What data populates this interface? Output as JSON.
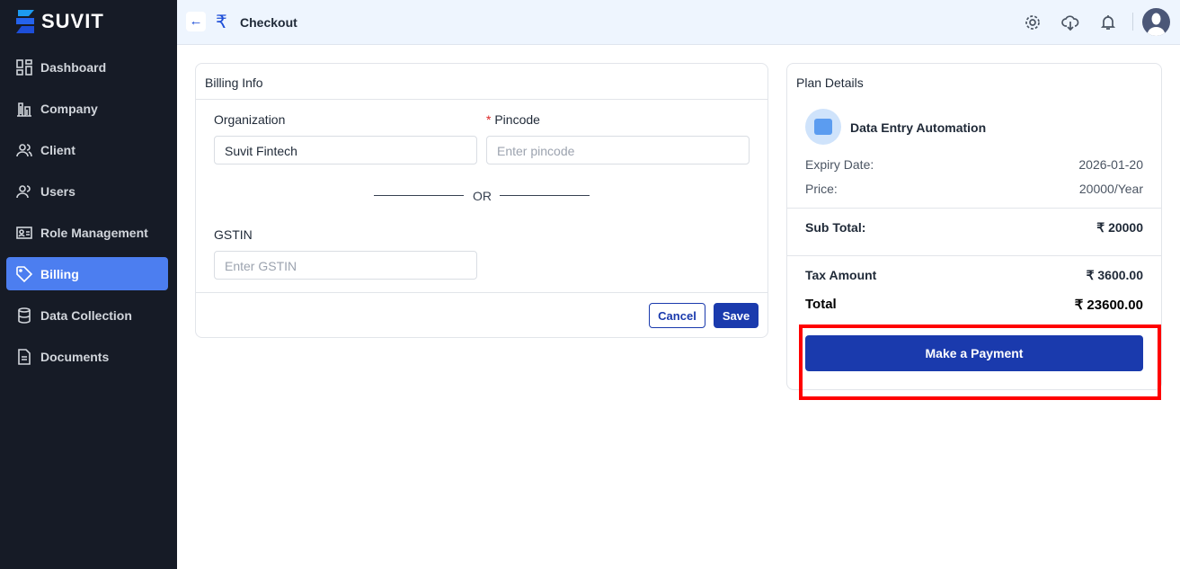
{
  "brand": "SUVIT",
  "sidebar": {
    "items": [
      {
        "label": "Dashboard",
        "icon": "dashboard-icon"
      },
      {
        "label": "Company",
        "icon": "building-icon"
      },
      {
        "label": "Client",
        "icon": "client-icon"
      },
      {
        "label": "Users",
        "icon": "users-icon"
      },
      {
        "label": "Role Management",
        "icon": "role-icon"
      },
      {
        "label": "Billing",
        "icon": "tag-icon",
        "active": true
      },
      {
        "label": "Data Collection",
        "icon": "database-icon"
      },
      {
        "label": "Documents",
        "icon": "document-icon"
      }
    ]
  },
  "header": {
    "title": "Checkout",
    "icons": [
      "settings-icon",
      "cloud-download-icon",
      "bell-icon",
      "avatar"
    ]
  },
  "billing": {
    "title": "Billing Info",
    "organization_label": "Organization",
    "organization_value": "Suvit Fintech",
    "pincode_label": "Pincode",
    "pincode_required": "*",
    "pincode_placeholder": "Enter pincode",
    "or": "OR",
    "gstin_label": "GSTIN",
    "gstin_placeholder": "Enter GSTIN",
    "cancel": "Cancel",
    "save": "Save"
  },
  "plan": {
    "title": "Plan Details",
    "name": "Data Entry Automation",
    "expiry_label": "Expiry Date:",
    "expiry_value": "2026-01-20",
    "price_label": "Price:",
    "price_value": "20000/Year",
    "subtotal_label": "Sub Total:",
    "subtotal_value": "₹ 20000",
    "tax_label": "Tax Amount",
    "tax_value": "₹ 3600.00",
    "total_label": "Total",
    "total_value": "₹ 23600.00",
    "pay_button": "Make a Payment"
  },
  "colors": {
    "sidebar": "#161b26",
    "active": "#4c7ef0",
    "primary": "#1a3aad",
    "highlight": "#ff0000"
  }
}
